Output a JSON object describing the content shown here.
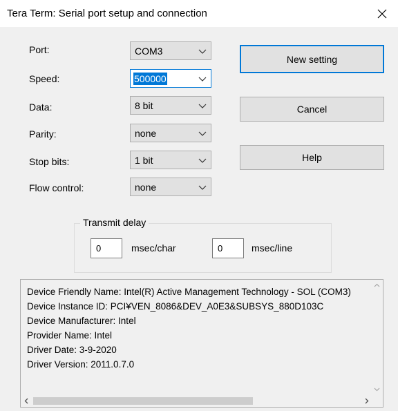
{
  "window": {
    "title": "Tera Term: Serial port setup and connection"
  },
  "fields": [
    {
      "label": "Port:",
      "value": "COM3"
    },
    {
      "label": "Speed:",
      "value": "500000"
    },
    {
      "label": "Data:",
      "value": "8 bit"
    },
    {
      "label": "Parity:",
      "value": "none"
    },
    {
      "label": "Stop bits:",
      "value": "1 bit"
    },
    {
      "label": "Flow control:",
      "value": "none"
    }
  ],
  "buttons": {
    "new_setting": "New setting",
    "cancel": "Cancel",
    "help": "Help"
  },
  "transmit_delay": {
    "legend": "Transmit delay",
    "char_value": "0",
    "char_unit": "msec/char",
    "line_value": "0",
    "line_unit": "msec/line"
  },
  "device_info": [
    "Device Friendly Name: Intel(R) Active Management Technology - SOL (COM3)",
    "Device Instance ID: PCI¥VEN_8086&DEV_A0E3&SUBSYS_880D103C",
    "Device Manufacturer: Intel",
    "Provider Name: Intel",
    "Driver Date: 3-9-2020",
    "Driver Version: 2011.0.7.0"
  ],
  "colors": {
    "accent": "#0078d7",
    "button_face": "#e1e1e1",
    "dialog_bg": "#f0f0f0"
  }
}
